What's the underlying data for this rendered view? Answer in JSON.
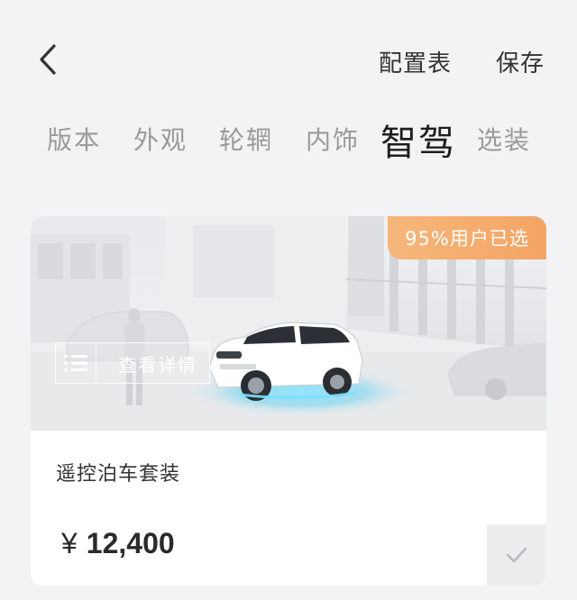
{
  "header": {
    "config_label": "配置表",
    "save_label": "保存"
  },
  "tabs": [
    {
      "label": "版本",
      "active": false
    },
    {
      "label": "外观",
      "active": false
    },
    {
      "label": "轮辋",
      "active": false
    },
    {
      "label": "内饰",
      "active": false
    },
    {
      "label": "智驾",
      "active": true
    },
    {
      "label": "选装",
      "active": false
    }
  ],
  "card": {
    "badge": "95%用户已选",
    "details_label": "查看详情",
    "package_name": "遥控泊车套装",
    "currency": "¥",
    "price": "12,400",
    "selected": true
  },
  "colors": {
    "badge": "#f4a565",
    "active_tab": "#1e1e1e",
    "inactive_tab": "#9a9a9c",
    "car_glow": "#6fd3f0"
  },
  "icons": {
    "back": "chevron-left-icon",
    "details": "list-icon",
    "check": "checkmark-icon"
  }
}
